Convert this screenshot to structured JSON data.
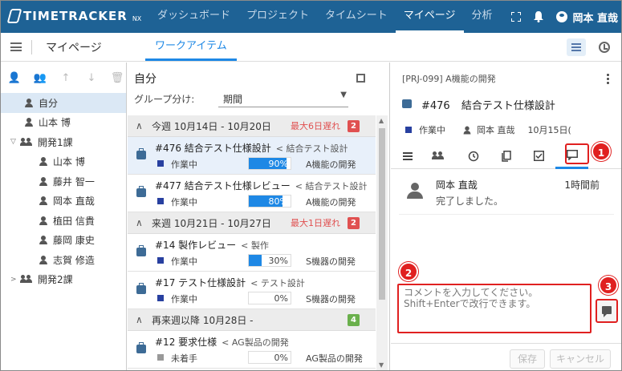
{
  "app": {
    "logo": "TIMETRACKER",
    "logo_suffix": "NX"
  },
  "nav": [
    "ダッシュボード",
    "プロジェクト",
    "タイムシート",
    "マイページ",
    "分析"
  ],
  "user": {
    "name": "岡本 直哉"
  },
  "subbar": {
    "page_title": "マイページ",
    "tab": "ワークアイテム"
  },
  "tree": [
    {
      "label": "自分",
      "type": "person",
      "level": 0,
      "selected": true
    },
    {
      "label": "山本 博",
      "type": "person",
      "level": 0
    },
    {
      "label": "開発1課",
      "type": "group",
      "level": 0,
      "expanded": true
    },
    {
      "label": "山本 博",
      "type": "person",
      "level": 1
    },
    {
      "label": "藤井 智一",
      "type": "person",
      "level": 1
    },
    {
      "label": "岡本 直哉",
      "type": "person",
      "level": 1
    },
    {
      "label": "植田 信貴",
      "type": "person",
      "level": 1
    },
    {
      "label": "藤岡 康史",
      "type": "person",
      "level": 1
    },
    {
      "label": "志賀 修造",
      "type": "person",
      "level": 1
    },
    {
      "label": "開発2課",
      "type": "group",
      "level": 0,
      "expanded": false
    }
  ],
  "mid": {
    "title": "自分",
    "group_label": "グループ分け:",
    "group_value": "期間"
  },
  "groups": [
    {
      "title": "今週 10月14日 - 10月20日",
      "late": "最大6日遅れ",
      "count": "2",
      "count_color": "#e05050",
      "items": [
        {
          "title": "#476 結合テスト仕様設計",
          "parent": "< 結合テスト設計",
          "status": "作業中",
          "progress": 90,
          "progress_label": "90%",
          "project": "A機能の開発",
          "selected": true
        },
        {
          "title": "#477 結合テスト仕様レビュー",
          "parent": "< 結合テスト設計",
          "status": "作業中",
          "progress": 80,
          "progress_label": "80%",
          "project": "A機能の開発"
        }
      ]
    },
    {
      "title": "来週 10月21日 - 10月27日",
      "late": "最大1日遅れ",
      "count": "2",
      "count_color": "#e05050",
      "items": [
        {
          "title": "#14 製作レビュー",
          "parent": "< 製作",
          "status": "作業中",
          "progress": 30,
          "progress_label": "30%",
          "project": "S機器の開発"
        },
        {
          "title": "#17 テスト仕様設計",
          "parent": "< テスト設計",
          "status": "作業中",
          "progress": 0,
          "progress_label": "0%",
          "project": "S機器の開発"
        }
      ]
    },
    {
      "title": "再来週以降 10月28日 -",
      "late": "",
      "count": "4",
      "count_color": "#6ab04c",
      "items": [
        {
          "title": "#12 要求仕様",
          "parent": "< AG製品の開発",
          "status": "未着手",
          "status_gray": true,
          "progress": 0,
          "progress_label": "0%",
          "project": "AG製品の開発"
        }
      ]
    }
  ],
  "detail": {
    "breadcrumb": "[PRJ-099] A機能の開発",
    "number": "#476",
    "title": "結合テスト仕様設計",
    "status": "作業中",
    "assignee": "岡本 直哉",
    "date": "10月15日(",
    "comment": {
      "author": "岡本 直哉",
      "time": "1時間前",
      "text": "完了しました。"
    },
    "comment_placeholder": "コメントを入力してください。\nShift+Enterで改行できます。",
    "save": "保存",
    "cancel": "キャンセル"
  },
  "annotations": [
    "1",
    "2",
    "3"
  ]
}
